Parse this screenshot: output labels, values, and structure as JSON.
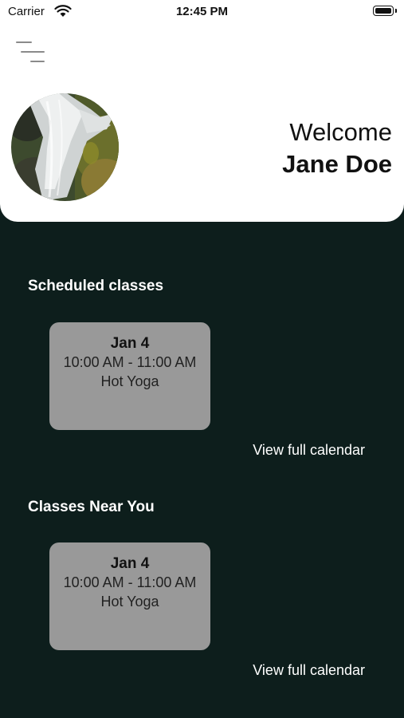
{
  "status_bar": {
    "carrier": "Carrier",
    "time": "12:45 PM"
  },
  "header": {
    "welcome": "Welcome",
    "user_name": "Jane Doe"
  },
  "sections": [
    {
      "title": "Scheduled classes",
      "card": {
        "date": "Jan 4",
        "time": "10:00 AM - 11:00 AM",
        "name": "Hot Yoga"
      },
      "link": "View full calendar"
    },
    {
      "title": "Classes Near You",
      "card": {
        "date": "Jan 4",
        "time": "10:00 AM - 11:00 AM",
        "name": "Hot Yoga"
      },
      "link": "View full calendar"
    }
  ],
  "colors": {
    "background": "#0d1e1c",
    "card": "#999999",
    "header": "#ffffff"
  },
  "icons": {
    "menu": "menu-icon",
    "wifi": "wifi-icon",
    "battery": "battery-icon"
  }
}
